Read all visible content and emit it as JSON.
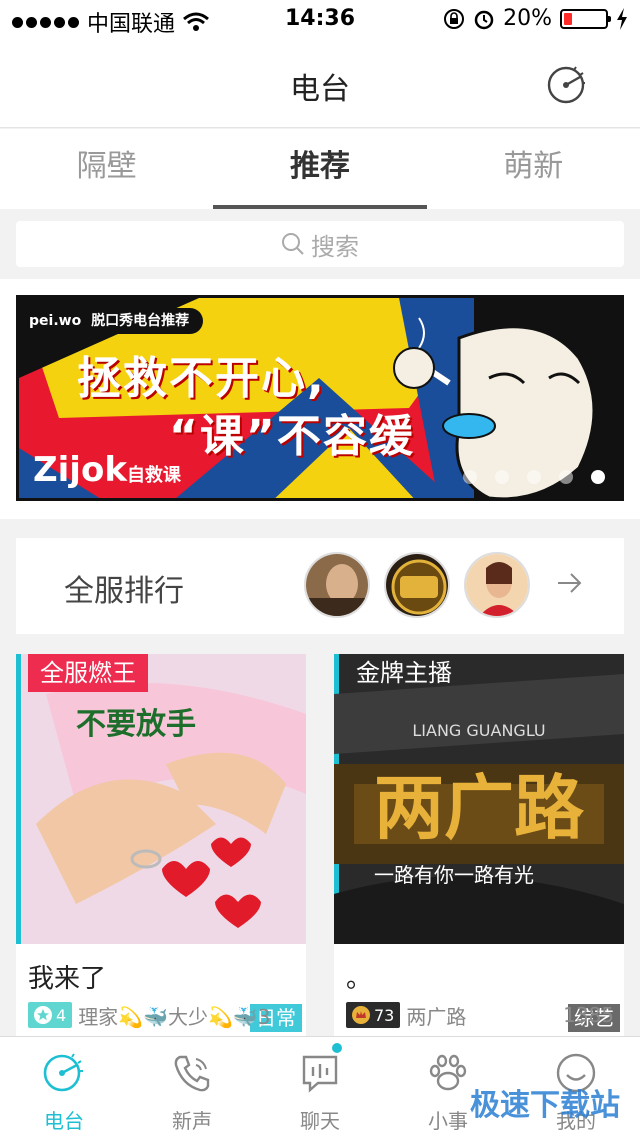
{
  "status_bar": {
    "carrier": "中国联通",
    "time": "14:36",
    "battery": "20%"
  },
  "header": {
    "title": "电台"
  },
  "tabs": [
    {
      "label": "隔壁",
      "active": false
    },
    {
      "label": "推荐",
      "active": true
    },
    {
      "label": "萌新",
      "active": false
    }
  ],
  "search": {
    "placeholder": "搜索"
  },
  "banner": {
    "tag_brand": "pei.wo",
    "tag_text": "脱口秀电台推荐",
    "line1": "拯救不开心,",
    "line2": "“课”不容缓",
    "brand": "Zijok",
    "brand_sub": "自救课",
    "dots": 5,
    "active_dot": 4
  },
  "ranking": {
    "label": "全服排行"
  },
  "cards": [
    {
      "badge": "全服燃王",
      "image_text": "不要放手",
      "genre": "日常",
      "name": "我来了",
      "level": "4",
      "members": "理家💫🐳大少💫🐳3"
    },
    {
      "badge": "金牌主播",
      "image_text_top": "LIANG GUANGLU",
      "image_text_big": "两广路",
      "image_text_sub": "一路有你一路有光",
      "genre": "综艺",
      "name": "。",
      "level": "73",
      "members": "两广路",
      "count": "1385"
    }
  ],
  "tabbar": [
    {
      "label": "电台",
      "icon": "radio-icon",
      "active": true
    },
    {
      "label": "新声",
      "icon": "phone-icon",
      "active": false
    },
    {
      "label": "聊天",
      "icon": "chat-icon",
      "active": false
    },
    {
      "label": "小事",
      "icon": "paw-icon",
      "active": false
    },
    {
      "label": "我的",
      "icon": "smile-icon",
      "active": false
    }
  ],
  "watermark": "极速下载站",
  "colors": {
    "accent": "#1ebfd2",
    "badge_red": "#ee2c4f",
    "banner_red": "#e8182e",
    "banner_yellow": "#f4d20f"
  }
}
